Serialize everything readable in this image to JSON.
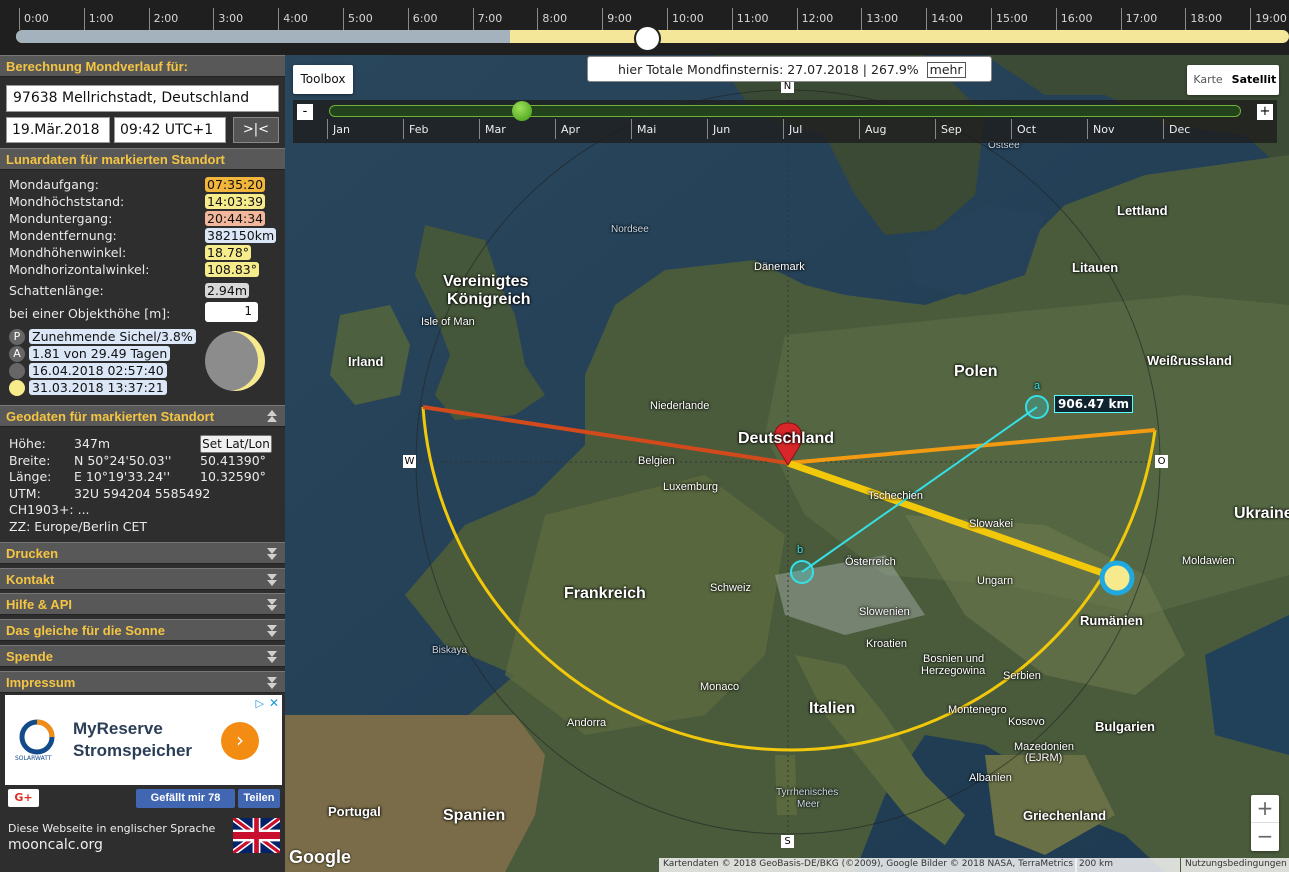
{
  "timeline": {
    "hours": [
      "0:00",
      "1:00",
      "2:00",
      "3:00",
      "4:00",
      "5:00",
      "6:00",
      "7:00",
      "8:00",
      "9:00",
      "10:00",
      "11:00",
      "12:00",
      "13:00",
      "14:00",
      "15:00",
      "16:00",
      "17:00",
      "18:00",
      "19:00"
    ],
    "night_fraction": 0.388,
    "knob_time": "09:42"
  },
  "sidebar": {
    "calc_title": "Berechnung Mondverlauf für:",
    "location": "97638 Mellrichstadt, Deutschland",
    "date": "19.Mär.2018",
    "time": "09:42 UTC+1",
    "now_button": ">|<",
    "lunar_title": "Lunardaten für markierten Standort",
    "lunar": [
      {
        "label": "Mondaufgang:",
        "value": "07:35:20",
        "color": "#f2b63c"
      },
      {
        "label": "Mondhöchststand:",
        "value": "14:03:39",
        "color": "#f7ec8c"
      },
      {
        "label": "Monduntergang:",
        "value": "20:44:34",
        "color": "#f3b89c"
      },
      {
        "label": "Mondentfernung:",
        "value": "382150km",
        "color": "#dbe7f7"
      },
      {
        "label": "Mondhöhenwinkel:",
        "value": "18.78°",
        "color": "#f7ec8c"
      },
      {
        "label": "Mondhorizontalwinkel:",
        "value": "108.83°",
        "color": "#f7ec8c"
      }
    ],
    "shadow_label": "Schattenlänge:",
    "shadow_value": "2.94m",
    "object_label": "bei einer Objekthöhe [m]:",
    "object_value": "1",
    "phases": [
      {
        "icon": "P",
        "text": "Zunehmende Sichel/3.8%"
      },
      {
        "icon": "A",
        "text": "1.81 von 29.49 Tagen"
      },
      {
        "icon": "",
        "text": "16.04.2018 02:57:40"
      },
      {
        "icon": "",
        "text": "31.03.2018 13:37:21"
      }
    ],
    "geo_title": "Geodaten für markierten Standort",
    "geo": {
      "hoehe_label": "Höhe:",
      "hoehe": "347m",
      "breite_label": "Breite:",
      "breite": "N 50°24'50.03''",
      "breite_dec": "50.41390°",
      "laenge_label": "Länge:",
      "laenge": "E 10°19'33.24''",
      "laenge_dec": "10.32590°",
      "utm_label": "UTM:",
      "utm": "32U 594204 5585492",
      "ch": "CH1903+: ...",
      "zz": "ZZ: Europe/Berlin  CET"
    },
    "set_latlon": "Set Lat/Lon",
    "sections": [
      "Drucken",
      "Kontakt",
      "Hilfe & API",
      "Das gleiche für die Sonne",
      "Spende",
      "Impressum"
    ],
    "ad": {
      "line1": "MyReserve",
      "line2": "Stromspeicher",
      "brand": "SOLARWATT"
    },
    "gplus": "G+",
    "like": "Gefällt mir 78",
    "share": "Teilen",
    "english_text": "Diese Webseite in englischer Sprache",
    "english_url": "mooncalc.org"
  },
  "map": {
    "toolbox": "Toolbox",
    "eclipse_text": "hier Totale Mondfinsternis: 27.07.2018 | 267.9%",
    "eclipse_more": "mehr",
    "maptype_karte": "Karte",
    "maptype_satellit": "Satellit",
    "months": [
      "Jan",
      "Feb",
      "Mar",
      "Apr",
      "Mai",
      "Jun",
      "Jul",
      "Aug",
      "Sep",
      "Oct",
      "Nov",
      "Dec"
    ],
    "year_minus": "-",
    "year_plus": "+",
    "distance": "906.47 km",
    "point_a": "a",
    "point_b": "b",
    "compass": {
      "n": "N",
      "s": "S",
      "w": "W",
      "o": "O"
    },
    "zoom_in": "+",
    "zoom_out": "−",
    "google": "Google",
    "attribution": "Kartendaten © 2018 GeoBasis-DE/BKG (©2009), Google Bilder © 2018 NASA, TerraMetrics",
    "scale": "200 km",
    "terms": "Nutzungsbedingungen",
    "labels": {
      "uk": "Vereinigtes",
      "uk2": "Königreich",
      "irland": "Irland",
      "isle": "Isle of Man",
      "nordsee": "Nordsee",
      "ostsee": "Ostsee",
      "daenemark": "Dänemark",
      "lettland": "Lettland",
      "litauen": "Litauen",
      "weissrussland": "Weißrussland",
      "polen": "Polen",
      "niederlande": "Niederlande",
      "deutschland": "Deutschland",
      "belgien": "Belgien",
      "luxemburg": "Luxemburg",
      "tschechien": "Tschechien",
      "slowakei": "Slowakei",
      "ukraine": "Ukraine",
      "moldawien": "Moldawien",
      "oesterreich": "Österreich",
      "schweiz": "Schweiz",
      "frankreich": "Frankreich",
      "ungarn": "Ungarn",
      "rumaenien": "Rumänien",
      "slowenien": "Slowenien",
      "kroatien": "Kroatien",
      "bosnien": "Bosnien und",
      "bosnien2": "Herzegowina",
      "serbien": "Serbien",
      "biskaya": "Biskaya",
      "monaco": "Monaco",
      "italien": "Italien",
      "andorra": "Andorra",
      "montenegro": "Montenegro",
      "kosovo": "Kosovo",
      "bulgarien": "Bulgarien",
      "mazedonien": "Mazedonien",
      "ejrm": "(EJRM)",
      "albanien": "Albanien",
      "tyrrh": "Tyrrhenisches",
      "meer": "Meer",
      "portugal": "Portugal",
      "spanien": "Spanien",
      "griechenland": "Griechenland"
    }
  },
  "colors": {
    "accent": "#f5c542",
    "moonrise_line": "#d24a1c",
    "moonset_line": "#f29a12",
    "moon_line": "#f2c80a",
    "arc": "#f2c80a",
    "measure": "#35e0e6"
  }
}
